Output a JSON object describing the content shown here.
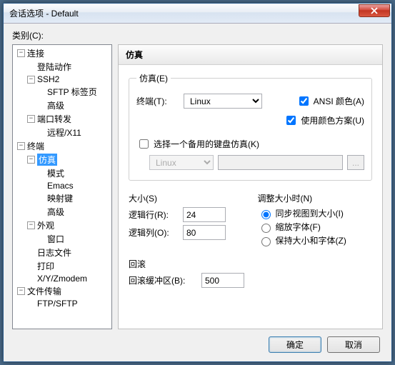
{
  "window": {
    "title": "会话选项 - Default"
  },
  "category_label": "类别(C):",
  "tree": {
    "conn": "连接",
    "login": "登陆动作",
    "ssh2": "SSH2",
    "sftp_tab": "SFTP 标签页",
    "advanced1": "高级",
    "port_fwd": "端口转发",
    "remote_x11": "远程/X11",
    "terminal": "终端",
    "emulation": "仿真",
    "mode": "模式",
    "emacs": "Emacs",
    "mapkeys": "映射键",
    "advanced2": "高级",
    "appearance": "外观",
    "window": "窗口",
    "logfile": "日志文件",
    "print": "打印",
    "xyz": "X/Y/Zmodem",
    "file_transfer": "文件传输",
    "ftp_sftp": "FTP/SFTP"
  },
  "header": "仿真",
  "emu": {
    "legend": "仿真(E)",
    "terminal_label": "终端(T):",
    "terminal_value": "Linux",
    "ansi_color": "ANSI 颜色(A)",
    "use_color_scheme": "使用颜色方案(U)",
    "alt_kb": "选择一个备用的键盘仿真(K)",
    "alt_kb_sel": "Linux",
    "dots": "..."
  },
  "size": {
    "title": "大小(S)",
    "rows_label": "逻辑行(R):",
    "rows_value": "24",
    "cols_label": "逻辑列(O):",
    "cols_value": "80"
  },
  "resize": {
    "title": "调整大小时(N)",
    "sync": "同步视图到大小(I)",
    "scale": "缩放字体(F)",
    "keep": "保持大小和字体(Z)"
  },
  "scrollback": {
    "title": "回滚",
    "buffer_label": "回滚缓冲区(B):",
    "buffer_value": "500"
  },
  "buttons": {
    "ok": "确定",
    "cancel": "取消"
  }
}
